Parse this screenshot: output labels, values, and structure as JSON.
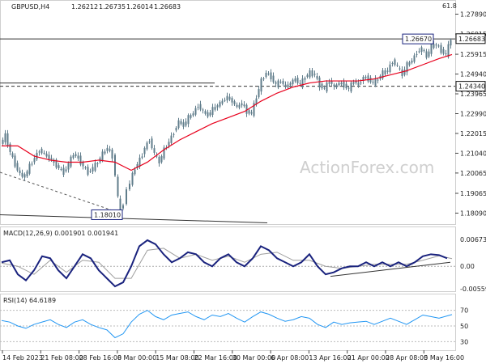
{
  "header": {
    "symbol": "GBPUSD,H4",
    "open": "1.26212",
    "high": "1.26735",
    "low": "1.26014",
    "close": "1.26683",
    "corner_value": "61.8"
  },
  "watermark": "ActionForex.com",
  "colors": {
    "candle": "#607d8b",
    "ma": "#e8001c",
    "macd": "#1a237e",
    "signal": "#9e9e9e",
    "rsi": "#2196f3",
    "level_box": "#1a237e"
  },
  "chart_data": [
    {
      "type": "candlestick",
      "title": "GBPUSD,H4",
      "y_ticks": [
        "1.27890",
        "1.26915",
        "1.25915",
        "1.24940",
        "1.23965",
        "1.22990",
        "1.22015",
        "1.21040",
        "1.20065",
        "1.19065",
        "1.18090"
      ],
      "ylim": [
        1.1775,
        1.2795
      ],
      "x_ticks": [
        "14 Feb 2023",
        "21 Feb 08:00",
        "28 Feb 16:00",
        "8 Mar 00:00",
        "15 Mar 08:00",
        "22 Mar 16:00",
        "30 Mar 00:00",
        "6 Apr 08:00",
        "13 Apr 16:00",
        "21 Apr 00:00",
        "28 Apr 08:00",
        "5 May 16:00"
      ],
      "close_path": [
        [
          0,
          1.215
        ],
        [
          6,
          1.219
        ],
        [
          12,
          1.211
        ],
        [
          18,
          1.205
        ],
        [
          24,
          1.2
        ],
        [
          30,
          1.199
        ],
        [
          36,
          1.204
        ],
        [
          42,
          1.208
        ],
        [
          48,
          1.212
        ],
        [
          54,
          1.21
        ],
        [
          60,
          1.208
        ],
        [
          66,
          1.206
        ],
        [
          72,
          1.203
        ],
        [
          78,
          1.201
        ],
        [
          84,
          1.205
        ],
        [
          90,
          1.21
        ],
        [
          96,
          1.208
        ],
        [
          102,
          1.204
        ],
        [
          108,
          1.201
        ],
        [
          114,
          1.203
        ],
        [
          120,
          1.206
        ],
        [
          126,
          1.21
        ],
        [
          132,
          1.213
        ],
        [
          138,
          1.209
        ],
        [
          142,
          1.2
        ],
        [
          145,
          1.188
        ],
        [
          148,
          1.182
        ],
        [
          152,
          1.186
        ],
        [
          156,
          1.192
        ],
        [
          160,
          1.196
        ],
        [
          166,
          1.203
        ],
        [
          172,
          1.207
        ],
        [
          178,
          1.213
        ],
        [
          184,
          1.217
        ],
        [
          190,
          1.21
        ],
        [
          196,
          1.206
        ],
        [
          202,
          1.212
        ],
        [
          208,
          1.216
        ],
        [
          214,
          1.221
        ],
        [
          220,
          1.226
        ],
        [
          226,
          1.224
        ],
        [
          232,
          1.228
        ],
        [
          238,
          1.23
        ],
        [
          244,
          1.234
        ],
        [
          250,
          1.231
        ],
        [
          256,
          1.229
        ],
        [
          262,
          1.232
        ],
        [
          268,
          1.234
        ],
        [
          274,
          1.236
        ],
        [
          280,
          1.238
        ],
        [
          286,
          1.236
        ],
        [
          292,
          1.233
        ],
        [
          298,
          1.235
        ],
        [
          304,
          1.231
        ],
        [
          310,
          1.23
        ],
        [
          316,
          1.238
        ],
        [
          322,
          1.246
        ],
        [
          328,
          1.25
        ],
        [
          334,
          1.248
        ],
        [
          340,
          1.244
        ],
        [
          346,
          1.246
        ],
        [
          352,
          1.243
        ],
        [
          358,
          1.245
        ],
        [
          364,
          1.247
        ],
        [
          370,
          1.244
        ],
        [
          376,
          1.248
        ],
        [
          382,
          1.25
        ],
        [
          388,
          1.249
        ],
        [
          394,
          1.244
        ],
        [
          400,
          1.242
        ],
        [
          406,
          1.246
        ],
        [
          412,
          1.243
        ],
        [
          418,
          1.245
        ],
        [
          424,
          1.244
        ],
        [
          430,
          1.242
        ],
        [
          436,
          1.246
        ],
        [
          442,
          1.244
        ],
        [
          448,
          1.248
        ],
        [
          454,
          1.247
        ],
        [
          460,
          1.245
        ],
        [
          466,
          1.247
        ],
        [
          472,
          1.25
        ],
        [
          478,
          1.251
        ],
        [
          484,
          1.256
        ],
        [
          490,
          1.253
        ],
        [
          496,
          1.249
        ],
        [
          502,
          1.254
        ],
        [
          508,
          1.256
        ],
        [
          514,
          1.26
        ],
        [
          520,
          1.262
        ],
        [
          526,
          1.258
        ],
        [
          532,
          1.263
        ],
        [
          538,
          1.264
        ],
        [
          544,
          1.261
        ],
        [
          550,
          1.259
        ],
        [
          556,
          1.2668
        ]
      ],
      "ma_path": [
        [
          0,
          1.214
        ],
        [
          20,
          1.214
        ],
        [
          40,
          1.209
        ],
        [
          60,
          1.207
        ],
        [
          80,
          1.206
        ],
        [
          100,
          1.206
        ],
        [
          120,
          1.207
        ],
        [
          140,
          1.206
        ],
        [
          160,
          1.202
        ],
        [
          180,
          1.206
        ],
        [
          200,
          1.212
        ],
        [
          220,
          1.217
        ],
        [
          240,
          1.221
        ],
        [
          260,
          1.225
        ],
        [
          280,
          1.228
        ],
        [
          300,
          1.231
        ],
        [
          320,
          1.236
        ],
        [
          340,
          1.24
        ],
        [
          360,
          1.243
        ],
        [
          380,
          1.245
        ],
        [
          400,
          1.246
        ],
        [
          420,
          1.246
        ],
        [
          440,
          1.246
        ],
        [
          460,
          1.247
        ],
        [
          480,
          1.249
        ],
        [
          500,
          1.251
        ],
        [
          520,
          1.254
        ],
        [
          540,
          1.257
        ],
        [
          556,
          1.259
        ]
      ],
      "levels": [
        {
          "label": "1.26670",
          "value": 1.2667
        },
        {
          "label": "1.24340",
          "value": 1.2434
        },
        {
          "label": "1.18010",
          "value": 1.1801
        }
      ],
      "current_price_label": "1.26683",
      "current_price": 1.26683
    },
    {
      "type": "line",
      "title": "MACD(12,26,9) 0.001901 0.001941",
      "y_ticks": [
        "0.006731",
        "0.00",
        "-0.005595"
      ],
      "ylim": [
        -0.0062,
        0.0075
      ],
      "series": [
        {
          "name": "MACD",
          "values": [
            [
              0,
              0.001
            ],
            [
              10,
              0.0015
            ],
            [
              20,
              -0.002
            ],
            [
              30,
              -0.0035
            ],
            [
              40,
              -0.001
            ],
            [
              50,
              0.0025
            ],
            [
              60,
              0.002
            ],
            [
              70,
              -0.001
            ],
            [
              80,
              -0.003
            ],
            [
              90,
              0.0
            ],
            [
              100,
              0.003
            ],
            [
              110,
              0.002
            ],
            [
              120,
              -0.001
            ],
            [
              130,
              -0.003
            ],
            [
              140,
              -0.005
            ],
            [
              150,
              -0.004
            ],
            [
              160,
              0.0
            ],
            [
              170,
              0.005
            ],
            [
              180,
              0.0065
            ],
            [
              190,
              0.0055
            ],
            [
              200,
              0.003
            ],
            [
              210,
              0.001
            ],
            [
              220,
              0.002
            ],
            [
              230,
              0.0035
            ],
            [
              240,
              0.003
            ],
            [
              250,
              0.001
            ],
            [
              260,
              0.0
            ],
            [
              270,
              0.002
            ],
            [
              280,
              0.003
            ],
            [
              290,
              0.001
            ],
            [
              300,
              0.0
            ],
            [
              310,
              0.002
            ],
            [
              320,
              0.005
            ],
            [
              330,
              0.004
            ],
            [
              340,
              0.002
            ],
            [
              350,
              0.001
            ],
            [
              360,
              0.0
            ],
            [
              370,
              0.001
            ],
            [
              380,
              0.003
            ],
            [
              390,
              0.0
            ],
            [
              400,
              -0.002
            ],
            [
              410,
              -0.0015
            ],
            [
              420,
              -0.0005
            ],
            [
              430,
              0.0
            ],
            [
              440,
              0.0
            ],
            [
              450,
              0.001
            ],
            [
              460,
              0.0
            ],
            [
              470,
              0.001
            ],
            [
              480,
              0.0
            ],
            [
              490,
              0.001
            ],
            [
              500,
              0.0
            ],
            [
              510,
              0.001
            ],
            [
              520,
              0.0025
            ],
            [
              530,
              0.003
            ],
            [
              540,
              0.0028
            ],
            [
              550,
              0.002
            ]
          ]
        },
        {
          "name": "Signal",
          "values": [
            [
              0,
              0.0008
            ],
            [
              20,
              0.0
            ],
            [
              40,
              -0.002
            ],
            [
              60,
              0.0015
            ],
            [
              80,
              -0.0015
            ],
            [
              100,
              0.0015
            ],
            [
              120,
              0.001
            ],
            [
              140,
              -0.003
            ],
            [
              160,
              -0.003
            ],
            [
              180,
              0.004
            ],
            [
              200,
              0.0045
            ],
            [
              220,
              0.002
            ],
            [
              240,
              0.003
            ],
            [
              260,
              0.0015
            ],
            [
              280,
              0.0025
            ],
            [
              300,
              0.001
            ],
            [
              320,
              0.003
            ],
            [
              340,
              0.0035
            ],
            [
              360,
              0.0015
            ],
            [
              380,
              0.0015
            ],
            [
              400,
              0.0
            ],
            [
              420,
              -0.0005
            ],
            [
              440,
              0.0
            ],
            [
              460,
              0.0005
            ],
            [
              480,
              0.0005
            ],
            [
              500,
              0.0005
            ],
            [
              520,
              0.0015
            ],
            [
              540,
              0.0026
            ],
            [
              556,
              0.0019
            ]
          ]
        }
      ],
      "trend_line": [
        [
          408,
          -0.0025
        ],
        [
          556,
          0.001
        ]
      ]
    },
    {
      "type": "line",
      "title": "RSI(14) 64.6189",
      "y_ticks": [
        "70",
        "50",
        "30"
      ],
      "ylim": [
        20,
        80
      ],
      "series": [
        {
          "name": "RSI",
          "values": [
            [
              0,
              57
            ],
            [
              10,
              55
            ],
            [
              20,
              50
            ],
            [
              30,
              47
            ],
            [
              40,
              52
            ],
            [
              50,
              55
            ],
            [
              60,
              58
            ],
            [
              70,
              52
            ],
            [
              80,
              48
            ],
            [
              90,
              55
            ],
            [
              100,
              58
            ],
            [
              110,
              52
            ],
            [
              120,
              48
            ],
            [
              130,
              45
            ],
            [
              140,
              35
            ],
            [
              150,
              40
            ],
            [
              160,
              55
            ],
            [
              170,
              65
            ],
            [
              180,
              70
            ],
            [
              190,
              62
            ],
            [
              200,
              58
            ],
            [
              210,
              64
            ],
            [
              220,
              66
            ],
            [
              230,
              68
            ],
            [
              240,
              62
            ],
            [
              250,
              58
            ],
            [
              260,
              64
            ],
            [
              270,
              62
            ],
            [
              280,
              66
            ],
            [
              290,
              60
            ],
            [
              300,
              55
            ],
            [
              310,
              62
            ],
            [
              320,
              68
            ],
            [
              330,
              65
            ],
            [
              340,
              60
            ],
            [
              350,
              56
            ],
            [
              360,
              58
            ],
            [
              370,
              62
            ],
            [
              380,
              60
            ],
            [
              390,
              52
            ],
            [
              400,
              48
            ],
            [
              410,
              55
            ],
            [
              420,
              52
            ],
            [
              430,
              54
            ],
            [
              440,
              55
            ],
            [
              450,
              56
            ],
            [
              460,
              52
            ],
            [
              470,
              56
            ],
            [
              480,
              60
            ],
            [
              490,
              56
            ],
            [
              500,
              52
            ],
            [
              510,
              58
            ],
            [
              520,
              64
            ],
            [
              530,
              62
            ],
            [
              540,
              60
            ],
            [
              556,
              64.6
            ]
          ]
        }
      ]
    }
  ]
}
